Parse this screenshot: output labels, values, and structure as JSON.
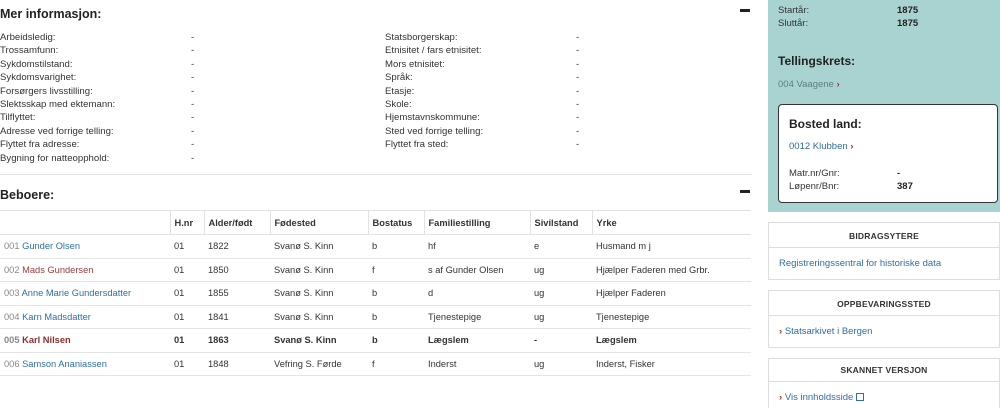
{
  "more_info": {
    "title": "Mer informasjon:",
    "left_rows": [
      {
        "label": "Arbeidsledig:",
        "value": "-"
      },
      {
        "label": "Trossamfunn:",
        "value": "-"
      },
      {
        "label": "Sykdomstilstand:",
        "value": "-"
      },
      {
        "label": "Sykdomsvarighet:",
        "value": "-"
      },
      {
        "label": "Forsørgers livsstilling:",
        "value": "-"
      },
      {
        "label": "Slektsskap med ektemann:",
        "value": "-"
      },
      {
        "label": "Tilflyttet:",
        "value": "-"
      },
      {
        "label": "Adresse ved forrige telling:",
        "value": "-"
      },
      {
        "label": "Flyttet fra adresse:",
        "value": "-"
      },
      {
        "label": "Bygning for natteopphold:",
        "value": "-"
      }
    ],
    "right_rows": [
      {
        "label": "Statsborgerskap:",
        "value": "-"
      },
      {
        "label": "Etnisitet / fars etnisitet:",
        "value": "-"
      },
      {
        "label": "Mors etnisitet:",
        "value": "-"
      },
      {
        "label": "Språk:",
        "value": "-"
      },
      {
        "label": "Etasje:",
        "value": "-"
      },
      {
        "label": "Skole:",
        "value": "-"
      },
      {
        "label": "Hjemstavnskommune:",
        "value": "-"
      },
      {
        "label": "Sted ved forrige telling:",
        "value": "-"
      },
      {
        "label": "Flyttet fra sted:",
        "value": "-"
      }
    ]
  },
  "residents": {
    "title": "Beboere:",
    "columns": [
      "",
      "H.nr",
      "Alder/født",
      "Fødested",
      "Bostatus",
      "Familiestilling",
      "Sivilstand",
      "Yrke"
    ],
    "rows": [
      {
        "num": "001",
        "name": "Gunder Olsen",
        "hnr": "01",
        "born": "1822",
        "birthplace": "Svanø S. Kinn",
        "status": "b",
        "family": "hf",
        "civil": "e",
        "occupation": "Husmand m j"
      },
      {
        "num": "002",
        "name": "Mads Gundersen",
        "hnr": "01",
        "born": "1850",
        "birthplace": "Svanø S. Kinn",
        "status": "f",
        "family": "s af Gunder Olsen",
        "civil": "ug",
        "occupation": "Hjælper Faderen med Grbr."
      },
      {
        "num": "003",
        "name": "Anne Marie Gundersdatter",
        "hnr": "01",
        "born": "1855",
        "birthplace": "Svanø S. Kinn",
        "status": "b",
        "family": "d",
        "civil": "ug",
        "occupation": "Hjælper Faderen"
      },
      {
        "num": "004",
        "name": "Karn Madsdatter",
        "hnr": "01",
        "born": "1841",
        "birthplace": "Svanø S. Kinn",
        "status": "b",
        "family": "Tjenestepige",
        "civil": "ug",
        "occupation": "Tjenestepige"
      },
      {
        "num": "005",
        "name": "Karl Nilsen",
        "hnr": "01",
        "born": "1863",
        "birthplace": "Svanø S. Kinn",
        "status": "b",
        "family": "Lægslem",
        "civil": "-",
        "occupation": "Lægslem"
      },
      {
        "num": "006",
        "name": "Samson Ananiassen",
        "hnr": "01",
        "born": "1848",
        "birthplace": "Vefring S. Førde",
        "status": "f",
        "family": "Inderst",
        "civil": "ug",
        "occupation": "Inderst, Fisker"
      }
    ]
  },
  "sidebar": {
    "start_label": "Startår:",
    "start_value": "1875",
    "end_label": "Sluttår:",
    "end_value": "1875",
    "tellingskrets_title": "Tellingskrets:",
    "tellingskrets_link": "004 Vaagene",
    "bosted_title": "Bosted land:",
    "bosted_link": "0012 Klubben",
    "matr_label": "Matr.nr/Gnr:",
    "matr_value": "-",
    "lopenr_label": "Løpenr/Bnr:",
    "lopenr_value": "387",
    "contributors_title": "BIDRAGSYTERE",
    "contributors_link": "Registreringssentral for historiske data",
    "storage_title": "OPPBEVARINGSSTED",
    "storage_link": "Statsarkivet i Bergen",
    "scanned_title": "SKANNET VERSJON",
    "scanned_link": "Vis innholdsside"
  },
  "colors": {
    "accent_teal": "#a9d3d0",
    "link_blue": "#2f6ea3",
    "chevron_red": "#b22a2a"
  }
}
